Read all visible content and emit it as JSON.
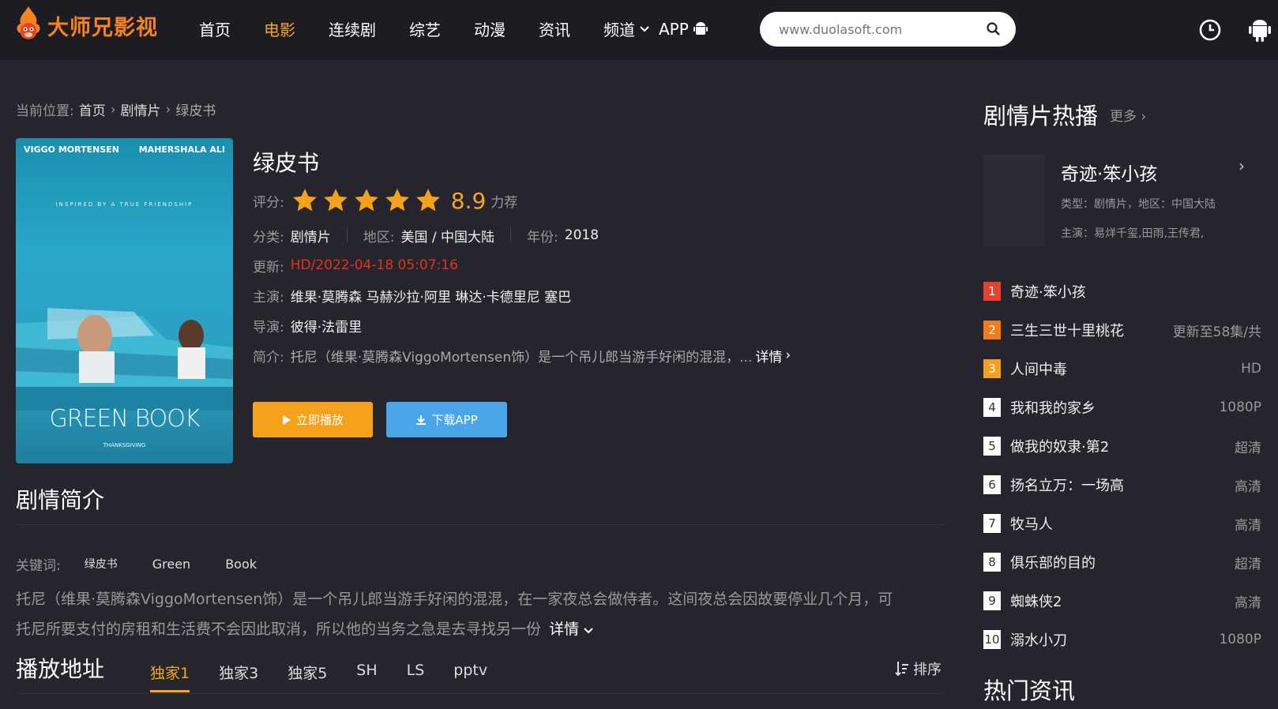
{
  "header": {
    "logo_text": "大师兄影视",
    "nav": [
      "首页",
      "电影",
      "连续剧",
      "综艺",
      "动漫",
      "资讯",
      "频道"
    ],
    "active_nav": "电影",
    "app_label": "APP",
    "search_placeholder": "www.duolasoft.com",
    "colors": {
      "accent": "#f5a623",
      "bg": "#1d1c22"
    }
  },
  "breadcrumb": {
    "label": "当前位置:",
    "home": "首页",
    "category": "剧情片",
    "current": "绿皮书"
  },
  "poster": {
    "actor_left": "VIGGO MORTENSEN",
    "actor_right": "MAHERSHALA ALI",
    "tagline": "INSPIRED BY A TRUE FRIENDSHIP",
    "title": "GREEN BOOK",
    "sub": "THANKSGIVING"
  },
  "movie": {
    "title": "绿皮书",
    "rating_label": "评分:",
    "stars": 5,
    "score": "8.9",
    "rec": "力荐",
    "category_label": "分类:",
    "category": "剧情片",
    "region_label": "地区:",
    "region": "美国 / 中国大陆",
    "year_label": "年份:",
    "year": "2018",
    "update_label": "更新:",
    "update": "HD/2022-04-18 05:07:16",
    "cast_label": "主演:",
    "cast": "维果·莫腾森 马赫沙拉·阿里 琳达·卡德里尼 塞巴",
    "director_label": "导演:",
    "director": "彼得·法雷里",
    "intro_label": "简介:",
    "intro": "托尼（维果·莫腾森ViggoMortensen饰）是一个吊儿郎当游手好闲的混混，...",
    "detail": "详情",
    "play_btn": "立即播放",
    "download_btn": "下载APP"
  },
  "plot_section": {
    "title": "剧情简介",
    "keywords_label": "关键词:",
    "keywords": [
      "绿皮书",
      "Green",
      "Book"
    ],
    "text_line1": "托尼（维果·莫腾森ViggoMortensen饰）是一个吊儿郎当游手好闲的混混，在一家夜总会做侍者。这间夜总会因故要停业几个月，可",
    "text_line2": "托尼所要支付的房租和生活费不会因此取消，所以他的当务之急是去寻找另一份",
    "detail": "详情"
  },
  "play_section": {
    "title": "播放地址",
    "tabs": [
      "独家1",
      "独家3",
      "独家5",
      "SH",
      "LS",
      "pptv"
    ],
    "active_tab": "独家1",
    "sort": "排序"
  },
  "sidebar": {
    "title": "剧情片热播",
    "more": "更多",
    "featured": {
      "title": "奇迹·笨小孩",
      "type_line": "类型：剧情片，地区：中国大陆",
      "cast_line": "主演：易烊千玺,田雨,王传君,"
    },
    "ranks": [
      {
        "num": "1",
        "name": "奇迹·笨小孩",
        "status": ""
      },
      {
        "num": "2",
        "name": "三生三世十里桃花",
        "status": "更新至58集/共"
      },
      {
        "num": "3",
        "name": "人间中毒",
        "status": "HD"
      },
      {
        "num": "4",
        "name": "我和我的家乡",
        "status": "1080P"
      },
      {
        "num": "5",
        "name": "做我的奴隶·第2",
        "status": "超清"
      },
      {
        "num": "6",
        "name": "扬名立万：一场高",
        "status": "高清"
      },
      {
        "num": "7",
        "name": "牧马人",
        "status": "高清"
      },
      {
        "num": "8",
        "name": "俱乐部的目的",
        "status": "超清"
      },
      {
        "num": "9",
        "name": "蜘蛛侠2",
        "status": "高清"
      },
      {
        "num": "10",
        "name": "溺水小刀",
        "status": "1080P"
      }
    ],
    "news_title": "热门资讯"
  }
}
